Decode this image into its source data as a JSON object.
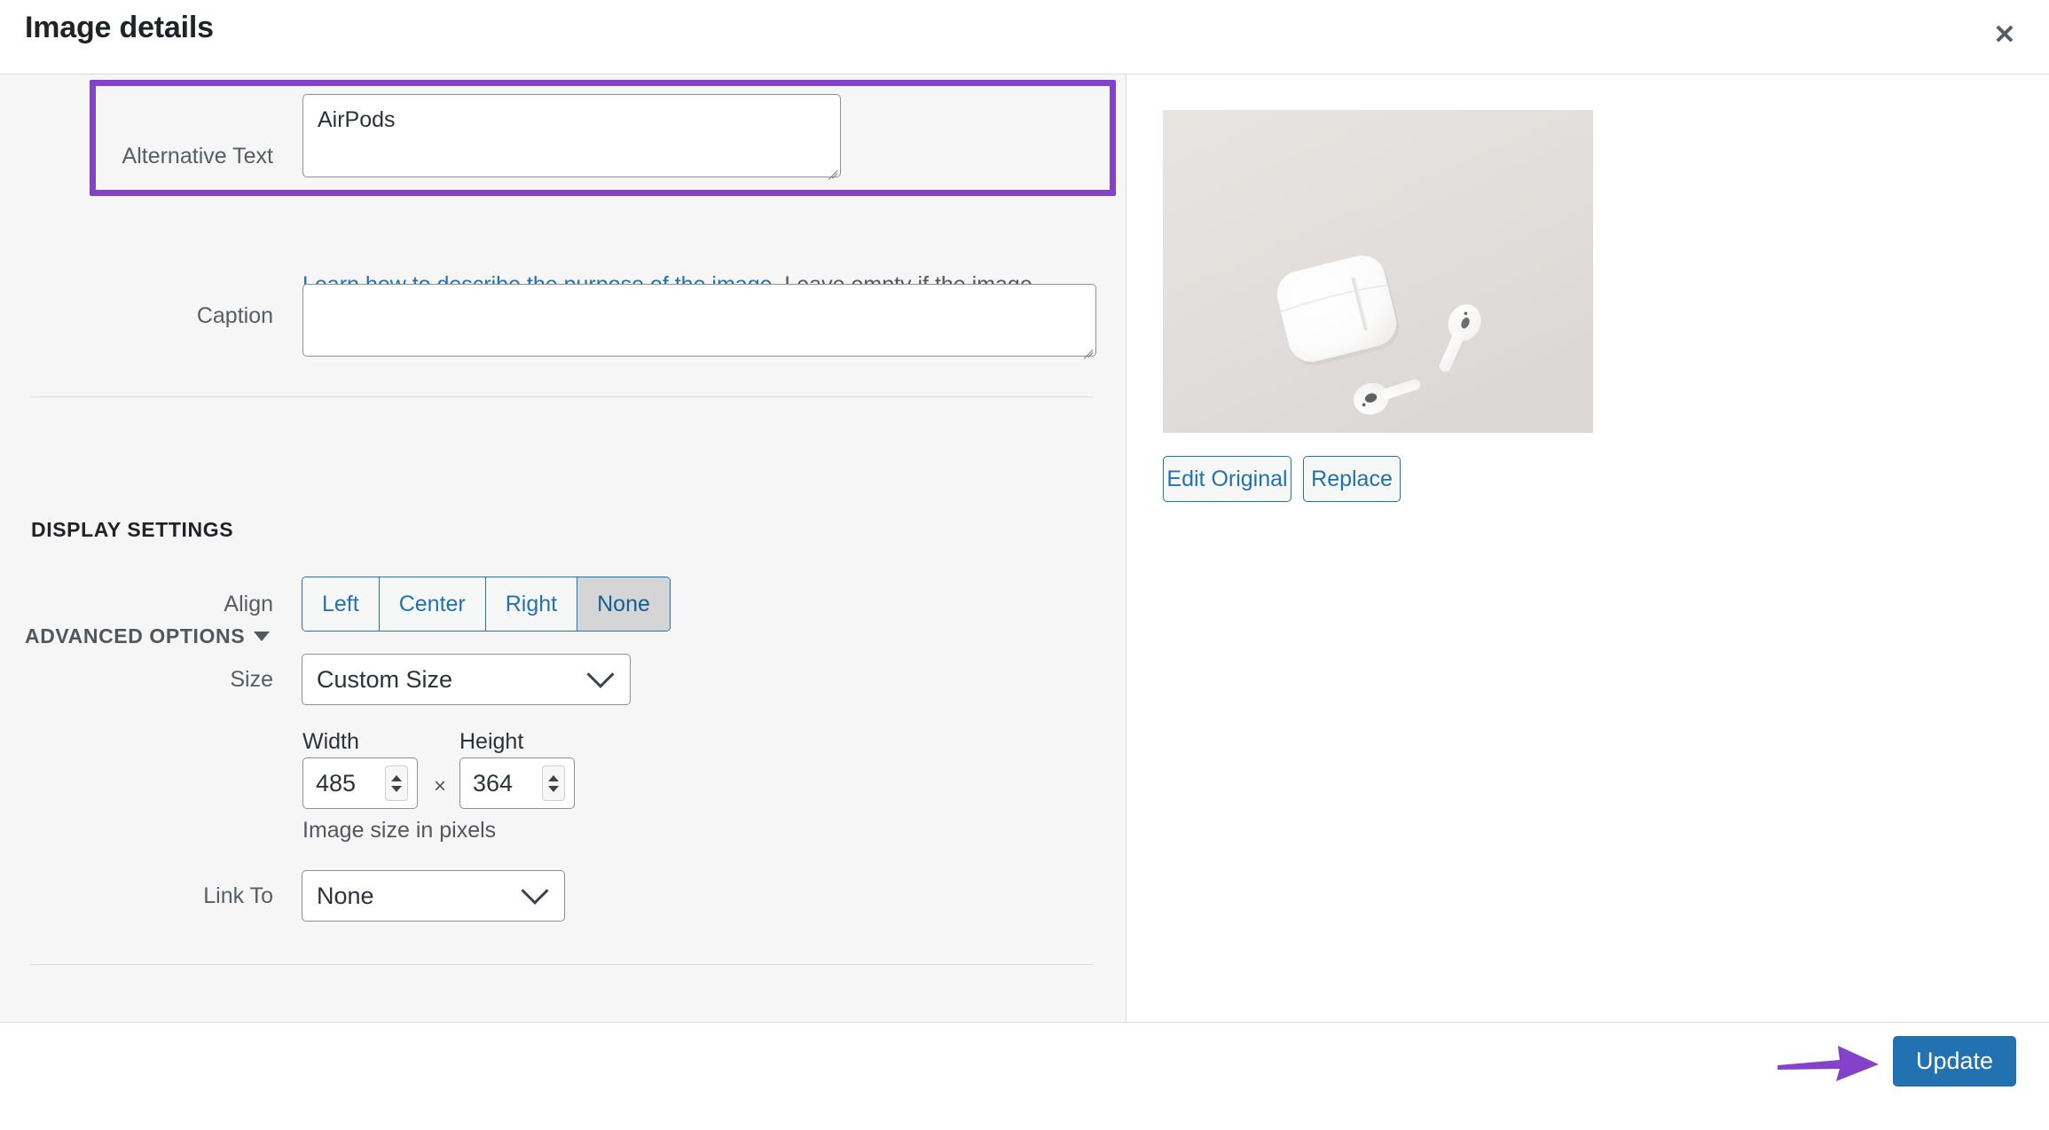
{
  "header": {
    "title": "Image details",
    "close_icon": "close-icon"
  },
  "alt_text_field": {
    "label": "Alternative Text",
    "value": "AirPods",
    "placeholder": "",
    "help_link": "Learn how to describe the purpose of the image",
    "help_rest": ". Leave empty if the image is purely decorative.",
    "highlight_color": "#8342c9"
  },
  "caption_field": {
    "label": "Caption",
    "value": "",
    "placeholder": ""
  },
  "display_settings": {
    "heading": "DISPLAY SETTINGS",
    "align": {
      "label": "Align",
      "options": [
        "Left",
        "Center",
        "Right",
        "None"
      ],
      "selected": "None"
    },
    "size": {
      "label": "Size",
      "selected": "Custom Size",
      "chevron_icon": "chevron-down-icon"
    },
    "dimensions": {
      "width_label": "Width",
      "height_label": "Height",
      "width_value": "485",
      "height_value": "364",
      "separator": "×",
      "hint": "Image size in pixels",
      "spinner_icon": "spinner-arrows-icon"
    },
    "link_to": {
      "label": "Link To",
      "selected": "None",
      "chevron_icon": "chevron-down-icon"
    }
  },
  "advanced_options": {
    "label": "ADVANCED OPTIONS",
    "toggle_icon": "triangle-down-icon",
    "expanded": false
  },
  "preview": {
    "image_alt": "AirPods",
    "image_description": "Photo of white AirPods earbuds and charging case on a light gray surface",
    "edit_original_label": "Edit Original",
    "replace_label": "Replace"
  },
  "footer": {
    "update_label": "Update",
    "annotation_icon": "purple-arrow-icon",
    "accent_color": "#2271b1",
    "annotation_color": "#8342c9"
  }
}
